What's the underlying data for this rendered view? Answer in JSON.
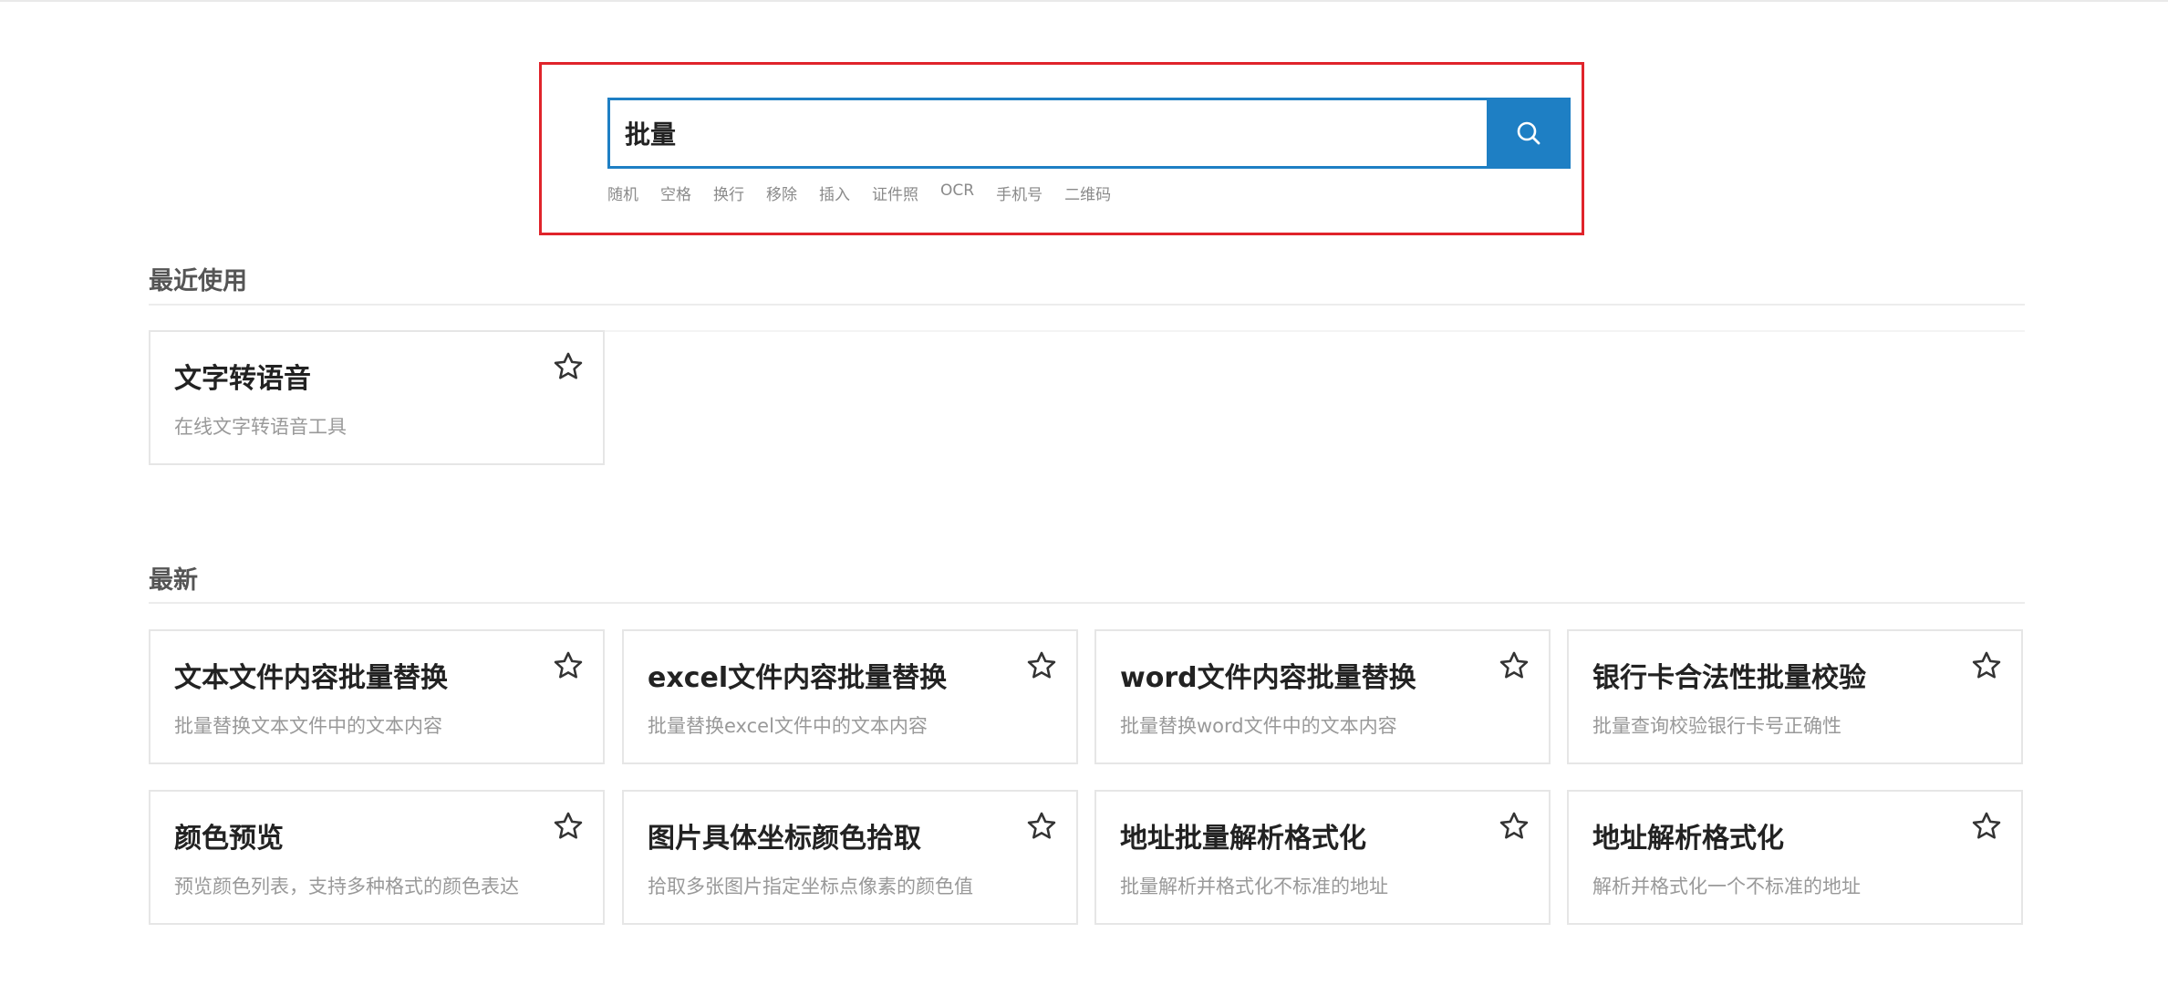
{
  "search": {
    "value": "批量",
    "button_icon": "search-icon",
    "hot_tags": [
      "随机",
      "空格",
      "换行",
      "移除",
      "插入",
      "证件照",
      "OCR",
      "手机号",
      "二维码"
    ]
  },
  "recent": {
    "title": "最近使用",
    "cards": [
      {
        "title": "文字转语音",
        "desc": "在线文字转语音工具"
      }
    ]
  },
  "latest": {
    "title": "最新",
    "cards": [
      {
        "title": "文本文件内容批量替换",
        "desc": "批量替换文本文件中的文本内容"
      },
      {
        "title": "excel文件内容批量替换",
        "desc": "批量替换excel文件中的文本内容"
      },
      {
        "title": "word文件内容批量替换",
        "desc": "批量替换word文件中的文本内容"
      },
      {
        "title": "银行卡合法性批量校验",
        "desc": "批量查询校验银行卡号正确性"
      },
      {
        "title": "颜色预览",
        "desc": "预览颜色列表，支持多种格式的颜色表达"
      },
      {
        "title": "图片具体坐标颜色拾取",
        "desc": "拾取多张图片指定坐标点像素的颜色值"
      },
      {
        "title": "地址批量解析格式化",
        "desc": "批量解析并格式化不标准的地址"
      },
      {
        "title": "地址解析格式化",
        "desc": "解析并格式化一个不标准的地址"
      }
    ]
  },
  "colors": {
    "highlight_border": "#e0242b",
    "accent": "#1e7fc4"
  },
  "icons": {
    "favorite": "star-outline-icon"
  }
}
